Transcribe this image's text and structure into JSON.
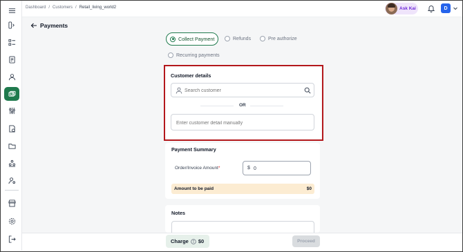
{
  "breadcrumb": {
    "items": [
      "Dashboard",
      "Customers",
      "Retail_living_world2"
    ],
    "separator": "/"
  },
  "header": {
    "ask_kai_label": "Ask Kai",
    "user_initial": "D"
  },
  "page": {
    "title": "Payments"
  },
  "payment_types": {
    "options": [
      "Collect Payment",
      "Refunds",
      "Pre authorize",
      "Recurring payments"
    ],
    "selected": "Collect Payment"
  },
  "customer_details": {
    "title": "Customer details",
    "search_placeholder": "Search customer",
    "or_label": "OR",
    "manual_placeholder": "Enter customer detail manually"
  },
  "payment_summary": {
    "title": "Payment Summary",
    "amount_label": "Order/Invoice Amount",
    "required_mark": "*",
    "currency_symbol": "$",
    "amount_value": "0",
    "to_be_paid_label": "Amount to be paid",
    "to_be_paid_value": "$0"
  },
  "notes": {
    "title": "Notes"
  },
  "footer": {
    "charge_label": "Charge",
    "charge_amount": "$0",
    "proceed_label": "Proceed"
  },
  "sidebar": {
    "icons": [
      "menu-icon",
      "expand-icon",
      "list-icon",
      "ledger-icon",
      "customer-icon",
      "payments-icon",
      "adjustments-icon",
      "invoice-icon",
      "folder-icon",
      "team-icon",
      "user-settings-icon",
      "store-icon",
      "settings-icon",
      "logout-icon"
    ],
    "active": "payments-icon"
  },
  "colors": {
    "accent": "#1f7a4d",
    "highlight_border": "#b3171b",
    "ask_kai_bg": "#efe4fb",
    "avatar_bg": "#2563eb",
    "to_be_paid_bg": "#fcecd2"
  }
}
